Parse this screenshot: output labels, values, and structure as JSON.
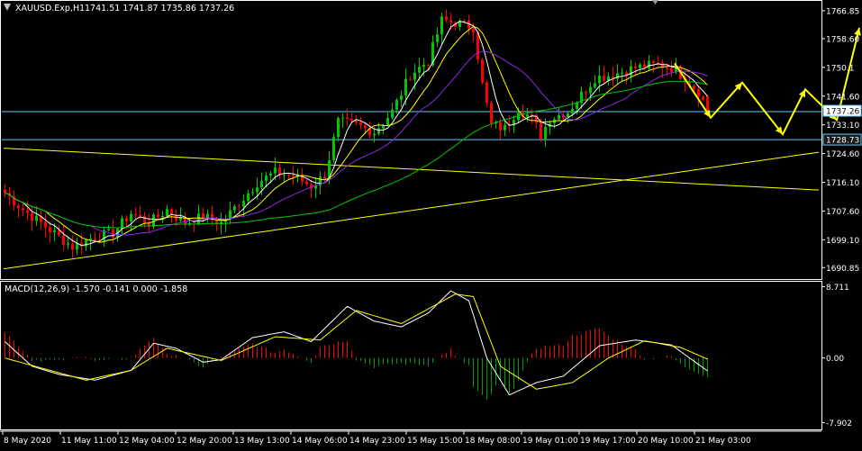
{
  "header": {
    "symbol_label": "XAUUSD.Exp,H1",
    "ohlc_label": "1741.51 1741.87 1735.86 1737.26"
  },
  "macd_header": {
    "label": "MACD(12,26,9) -1.570 -0.141 0.000 -1.858"
  },
  "colors": {
    "background": "#000000",
    "frame": "#ffffff",
    "bull_candle": "#00c800",
    "bear_candle": "#ff0000",
    "ma_fast": "#ffffff",
    "ma_mid": "#ffff00",
    "ma_slow": "#8a2be2",
    "ma_long": "#00c800",
    "trendline": "#ffff00",
    "level_line": "#5fc8ff",
    "forecast_arrow": "#ffff00",
    "macd_pos": "#ff0000",
    "macd_neg": "#00a000",
    "macd_line": "#ffffff",
    "signal_line": "#ffff00"
  },
  "chart_data": [
    {
      "type": "candlestick",
      "title": "XAUUSD.Exp,H1",
      "timeframe": "H1",
      "last_ohlc": {
        "open": 1741.51,
        "high": 1741.87,
        "low": 1735.86,
        "close": 1737.26
      },
      "ylim": [
        1688.0,
        1769.5
      ],
      "y_ticks": [
        "1766.85",
        "1758.60",
        "1750.1",
        "1741.60",
        "1733.10",
        "1724.60",
        "1716.10",
        "1707.60",
        "1699.10",
        "1690.85"
      ],
      "x_ticks": [
        "8 May 2020",
        "11 May 11:00",
        "12 May 04:00",
        "12 May 20:00",
        "13 May 13:00",
        "14 May 06:00",
        "14 May 23:00",
        "15 May 15:00",
        "18 May 08:00",
        "19 May 01:00",
        "19 May 17:00",
        "20 May 10:00",
        "21 May 03:00"
      ],
      "price_labels": [
        {
          "value": 1737.26,
          "label": "1737.26"
        },
        {
          "value": 1728.73,
          "label": "1728.73"
        }
      ],
      "horizontal_levels": [
        1737.0,
        1728.73
      ],
      "path_anchors": [
        {
          "t": 0,
          "price": 1713
        },
        {
          "t": 4,
          "price": 1708
        },
        {
          "t": 10,
          "price": 1702
        },
        {
          "t": 15,
          "price": 1697
        },
        {
          "t": 20,
          "price": 1700
        },
        {
          "t": 24,
          "price": 1701
        },
        {
          "t": 28,
          "price": 1707
        },
        {
          "t": 32,
          "price": 1704
        },
        {
          "t": 36,
          "price": 1708
        },
        {
          "t": 40,
          "price": 1704
        },
        {
          "t": 44,
          "price": 1706
        },
        {
          "t": 48,
          "price": 1704
        },
        {
          "t": 52,
          "price": 1710
        },
        {
          "t": 56,
          "price": 1716
        },
        {
          "t": 60,
          "price": 1719
        },
        {
          "t": 64,
          "price": 1718
        },
        {
          "t": 68,
          "price": 1715
        },
        {
          "t": 71,
          "price": 1718
        },
        {
          "t": 74,
          "price": 1734
        },
        {
          "t": 78,
          "price": 1733
        },
        {
          "t": 82,
          "price": 1731
        },
        {
          "t": 86,
          "price": 1737
        },
        {
          "t": 90,
          "price": 1748
        },
        {
          "t": 94,
          "price": 1752
        },
        {
          "t": 97,
          "price": 1764
        },
        {
          "t": 101,
          "price": 1763
        },
        {
          "t": 104,
          "price": 1762
        },
        {
          "t": 106,
          "price": 1745
        },
        {
          "t": 108,
          "price": 1733
        },
        {
          "t": 111,
          "price": 1732
        },
        {
          "t": 114,
          "price": 1738
        },
        {
          "t": 117,
          "price": 1735
        },
        {
          "t": 119,
          "price": 1730
        },
        {
          "t": 121,
          "price": 1735
        },
        {
          "t": 125,
          "price": 1737
        },
        {
          "t": 128,
          "price": 1742
        },
        {
          "t": 131,
          "price": 1747
        },
        {
          "t": 135,
          "price": 1748
        },
        {
          "t": 140,
          "price": 1750
        },
        {
          "t": 145,
          "price": 1751
        },
        {
          "t": 148,
          "price": 1750
        },
        {
          "t": 151,
          "price": 1747
        },
        {
          "t": 154,
          "price": 1743
        },
        {
          "t": 156,
          "price": 1737.26
        }
      ],
      "trendlines": [
        {
          "from": {
            "t": 0,
            "price": 1726.2
          },
          "to": {
            "t": 181,
            "price": 1713.8
          }
        },
        {
          "from": {
            "t": 0,
            "price": 1690.5
          },
          "to": {
            "t": 181,
            "price": 1725.0
          }
        }
      ],
      "forecast_path": [
        {
          "t": 149,
          "price": 1751.3
        },
        {
          "t": 157,
          "price": 1735.2
        },
        {
          "t": 164,
          "price": 1745.6
        },
        {
          "t": 173,
          "price": 1730.3
        },
        {
          "t": 178,
          "price": 1743.6
        },
        {
          "t": 185,
          "price": 1734.5
        },
        {
          "t": 190,
          "price": 1761.8
        }
      ],
      "moving_averages": [
        {
          "name": "fast",
          "color": "#ffffff",
          "period": 5
        },
        {
          "name": "mid",
          "color": "#ffff00",
          "period": 10
        },
        {
          "name": "slow",
          "color": "#8a2be2",
          "period": 20
        },
        {
          "name": "long",
          "color": "#00c800",
          "period": 60
        }
      ]
    },
    {
      "type": "histogram+line",
      "title": "MACD(12,26,9)",
      "values_label": "-1.570 -0.141 0.000 -1.858",
      "ylim": [
        -8.6,
        9.2
      ],
      "y_ticks": [
        "8.711",
        "0.00",
        "-7.902"
      ],
      "macd_anchors": [
        {
          "t": 0,
          "v": 2
        },
        {
          "t": 6,
          "v": -1
        },
        {
          "t": 12,
          "v": -2
        },
        {
          "t": 20,
          "v": -2.7
        },
        {
          "t": 28,
          "v": -1.5
        },
        {
          "t": 33,
          "v": 1.8
        },
        {
          "t": 38,
          "v": 1.2
        },
        {
          "t": 44,
          "v": -0.5
        },
        {
          "t": 48,
          "v": -0.2
        },
        {
          "t": 55,
          "v": 2.5
        },
        {
          "t": 62,
          "v": 3.2
        },
        {
          "t": 68,
          "v": 2
        },
        {
          "t": 76,
          "v": 6.3
        },
        {
          "t": 82,
          "v": 4.5
        },
        {
          "t": 88,
          "v": 3.8
        },
        {
          "t": 94,
          "v": 5.5
        },
        {
          "t": 99,
          "v": 8.2
        },
        {
          "t": 103,
          "v": 7
        },
        {
          "t": 107,
          "v": 0
        },
        {
          "t": 112,
          "v": -4.5
        },
        {
          "t": 118,
          "v": -3
        },
        {
          "t": 124,
          "v": -2.2
        },
        {
          "t": 132,
          "v": 1.5
        },
        {
          "t": 140,
          "v": 2.2
        },
        {
          "t": 148,
          "v": 1.6
        },
        {
          "t": 156,
          "v": -1.57
        }
      ],
      "signal_anchors": [
        {
          "t": 0,
          "v": 0
        },
        {
          "t": 10,
          "v": -1.5
        },
        {
          "t": 18,
          "v": -2.7
        },
        {
          "t": 28,
          "v": -1.5
        },
        {
          "t": 36,
          "v": 1.2
        },
        {
          "t": 48,
          "v": -0.3
        },
        {
          "t": 60,
          "v": 2.6
        },
        {
          "t": 70,
          "v": 2.2
        },
        {
          "t": 78,
          "v": 5.8
        },
        {
          "t": 88,
          "v": 4.2
        },
        {
          "t": 100,
          "v": 7.8
        },
        {
          "t": 104,
          "v": 7.5
        },
        {
          "t": 110,
          "v": -1
        },
        {
          "t": 118,
          "v": -3.8
        },
        {
          "t": 126,
          "v": -3
        },
        {
          "t": 134,
          "v": 0
        },
        {
          "t": 142,
          "v": 2.1
        },
        {
          "t": 150,
          "v": 1.3
        },
        {
          "t": 156,
          "v": -0.141
        }
      ]
    }
  ]
}
